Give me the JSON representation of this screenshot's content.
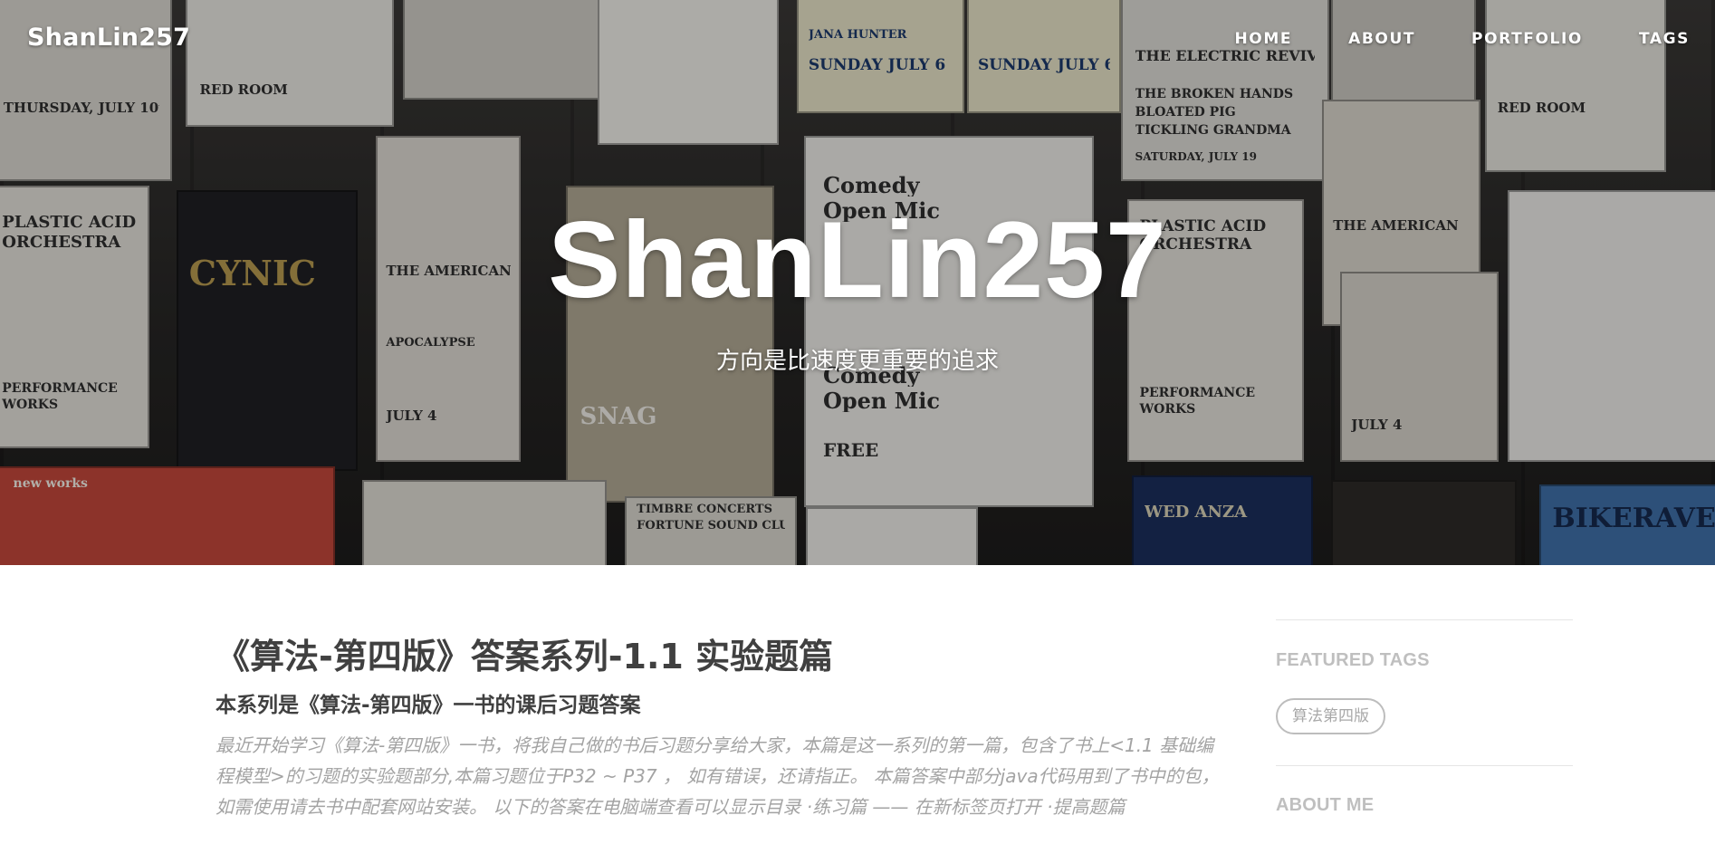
{
  "nav": {
    "brand": "ShanLin257",
    "links": [
      "HOME",
      "ABOUT",
      "PORTFOLIO",
      "TAGS"
    ]
  },
  "hero": {
    "title": "ShanLin257",
    "subtitle": "方向是比速度更重要的追求",
    "background": "concert-poster-wall-photo"
  },
  "post": {
    "title": "《算法-第四版》答案系列-1.1 实验题篇",
    "subtitle": "本系列是《算法-第四版》一书的课后习题答案",
    "excerpt": "最近开始学习《算法-第四版》一书，将我自己做的书后习题分享给大家，本篇是这一系列的第一篇，包含了书上<1.1 基础编程模型>的习题的实验题部分,本篇习题位于P32 ~ P37 ， 如有错误，还请指正。 本篇答案中部分java代码用到了书中的包，如需使用请去书中配套网站安装。 以下的答案在电脑端查看可以显示目录 ·练习篇 —— 在新标签页打开 ·提高题篇"
  },
  "sidebar": {
    "featured_tags_heading": "FEATURED TAGS",
    "tags": [
      "算法第四版"
    ],
    "about_heading": "ABOUT ME"
  },
  "posters": [
    "THURSDAY, JULY 10th",
    "SUNDAY JULY 6",
    "JANA HUNTER",
    "THE ELECTRIC REVIVAL",
    "THE BROKEN HANDS",
    "BLOATED PIG",
    "TICKLING GRANDMA",
    "SATURDAY, JULY 19",
    "Comedy",
    "Open Mic",
    "PLASTIC ACID",
    "ORCHESTRA",
    "CYNIC",
    "THE AMERICAN",
    "APOCALYPSE",
    "PERFORMANCE",
    "WORKS",
    "JULY 4",
    "RED ROOM",
    "FREE",
    "TIMBRE CONCERTS",
    "FORTUNE SOUND CLUB",
    "BIKERAVE",
    "SNAG",
    "WED ANZA",
    "new works"
  ],
  "colors": {
    "text_dark": "#404040",
    "text_muted": "#a3a3a3",
    "sidebar_heading": "#bfbfbf",
    "nav_text": "#ffffff"
  }
}
